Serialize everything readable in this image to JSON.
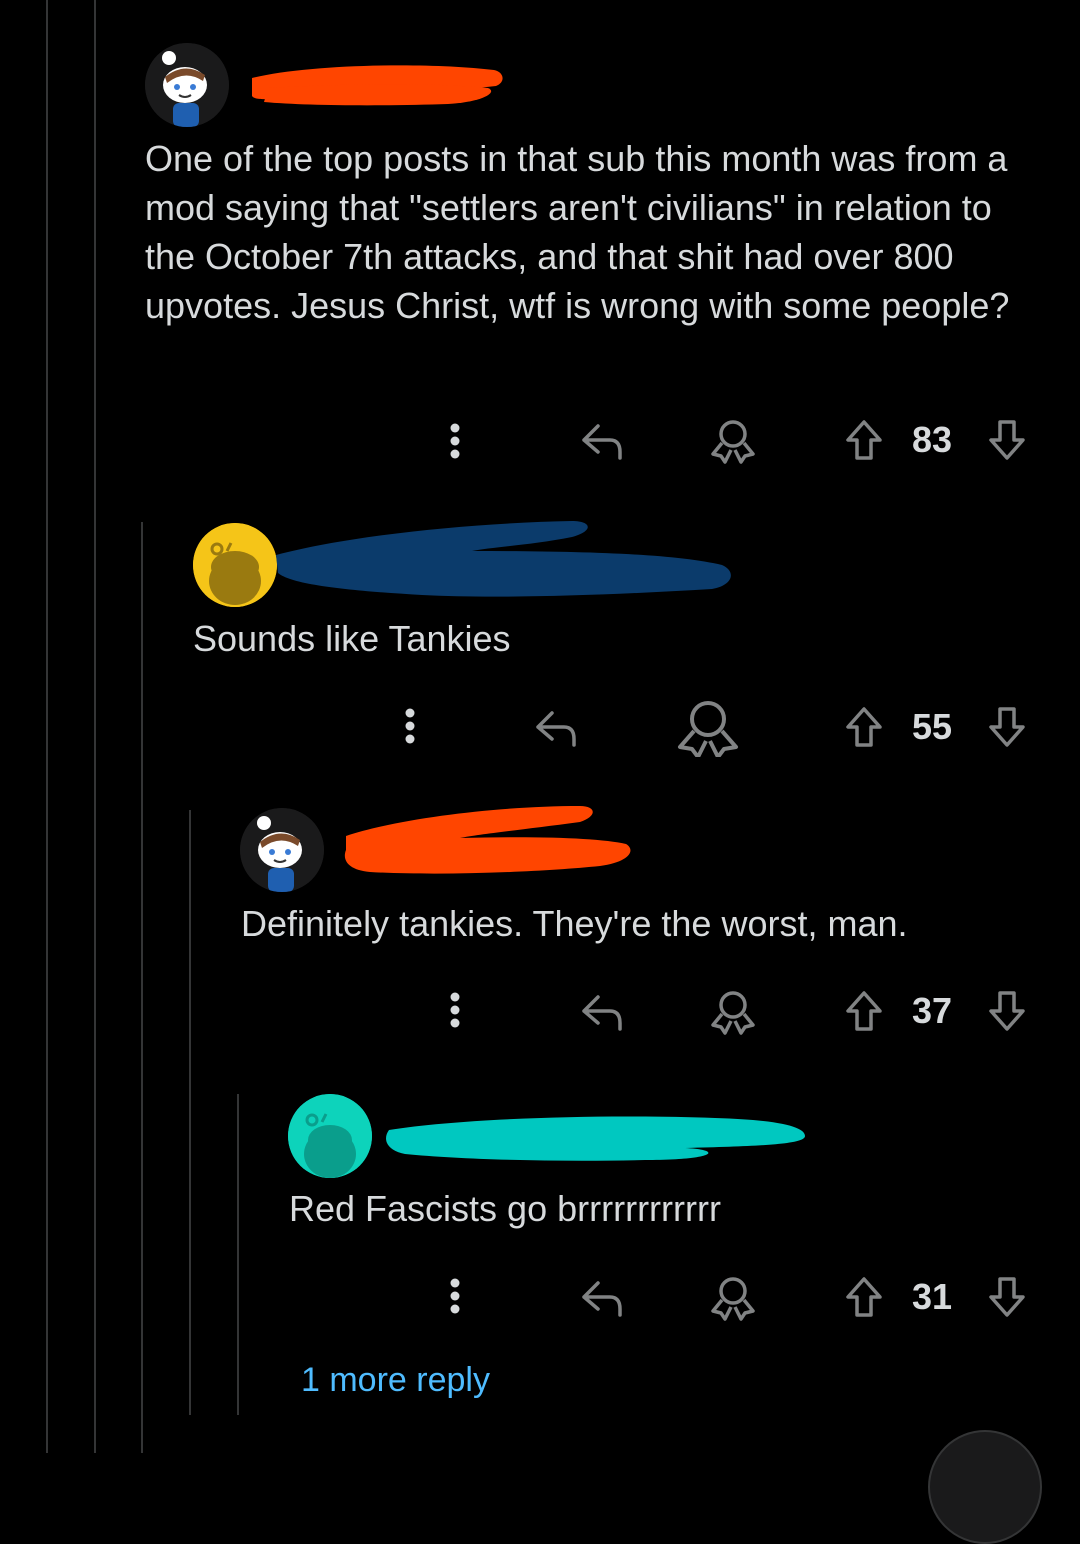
{
  "comments": [
    {
      "text": "One of the top posts in that sub this month was from a mod saying that \"settlers aren't civilians\" in relation to the October 7th attacks, and that shit had over 800 upvotes. Jesus Christ, wtf is wrong with some people?",
      "score": "83",
      "redaction_color": "#ff4500"
    },
    {
      "text": "Sounds like Tankies",
      "score": "55",
      "redaction_color": "#0b3b6b"
    },
    {
      "text": "Definitely tankies. They're the worst, man.",
      "score": "37",
      "redaction_color": "#ff4500"
    },
    {
      "text": "Red Fascists go brrrrrrrrrrrr",
      "score": "31",
      "redaction_color": "#00c8c0"
    }
  ],
  "more_replies_label": "1 more reply",
  "colors": {
    "background": "#000000",
    "text": "#d7dadc",
    "icon": "#818384",
    "link": "#4fbcff",
    "thread_line": "#343536"
  },
  "icons": [
    "more-options-icon",
    "reply-icon",
    "award-icon",
    "upvote-icon",
    "downvote-icon"
  ]
}
